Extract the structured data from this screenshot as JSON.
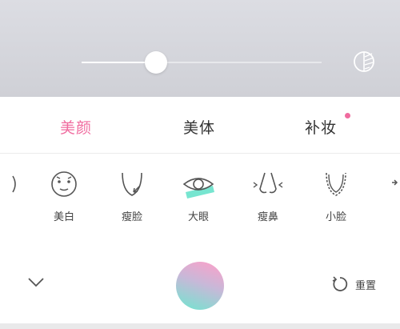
{
  "slider": {
    "value": 0.31
  },
  "tabs": [
    {
      "label": "美颜",
      "active": true
    },
    {
      "label": "美体",
      "active": false
    },
    {
      "label": "补妆",
      "active": false,
      "badge": true
    }
  ],
  "tools": [
    {
      "label": "",
      "icon": "partial-tool-icon"
    },
    {
      "label": "美白",
      "icon": "face-mask-icon"
    },
    {
      "label": "瘦脸",
      "icon": "face-slim-icon"
    },
    {
      "label": "大眼",
      "icon": "eye-icon",
      "selected": true
    },
    {
      "label": "瘦鼻",
      "icon": "nose-icon"
    },
    {
      "label": "小脸",
      "icon": "small-face-icon"
    },
    {
      "label": "",
      "icon": "partial-tool-icon"
    }
  ],
  "bottom": {
    "reset_label": "重置"
  },
  "colors": {
    "accent": "#f06b9f",
    "highlight": "#5fe0c8",
    "text": "#333333"
  }
}
